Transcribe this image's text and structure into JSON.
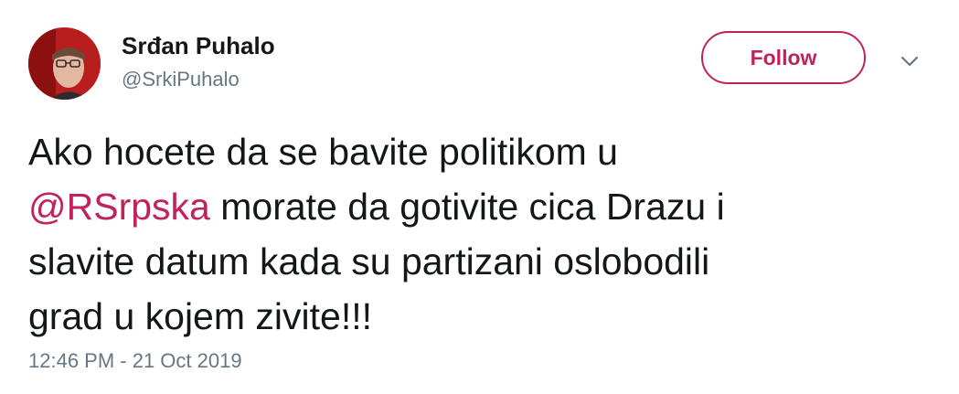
{
  "author": {
    "display_name": "Srđan Puhalo",
    "handle": "@SrkiPuhalo",
    "avatar_icon": "profile-photo"
  },
  "actions": {
    "follow_label": "Follow",
    "menu_icon": "chevron-down-icon"
  },
  "tweet": {
    "line1": "Ako hocete da se bavite politikom u",
    "mention": "@RSrpska",
    "line2_rest": " morate da gotivite cica Drazu i",
    "line3": "slavite datum kada su partizani oslobodili",
    "line4": "grad u kojem zivite!!!"
  },
  "timestamp": "12:46 PM - 21 Oct 2019",
  "colors": {
    "accent": "#c0235c",
    "text": "#14171a",
    "muted": "#657786"
  }
}
